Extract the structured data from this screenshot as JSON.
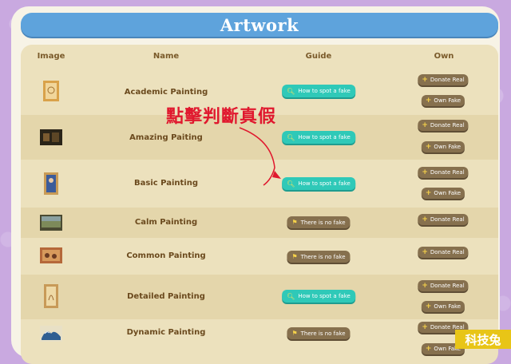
{
  "title": "Artwork",
  "columns": {
    "image": "Image",
    "name": "Name",
    "guide": "Guide",
    "own": "Own"
  },
  "rows": [
    {
      "name": "Academic Painting",
      "guide": "How to spot a fake",
      "fake": true,
      "donate": "Donate Real",
      "own": "Own Fake"
    },
    {
      "name": "Amazing Paiting",
      "guide": "How to spot a fake",
      "fake": true,
      "donate": "Donate Real",
      "own": "Own Fake"
    },
    {
      "name": "Basic Painting",
      "guide": "How to spot a fake",
      "fake": true,
      "donate": "Donate Real",
      "own": "Own Fake"
    },
    {
      "name": "Calm Painting",
      "guide": "There is no fake",
      "fake": false,
      "donate": "Donate Real"
    },
    {
      "name": "Common Painting",
      "guide": "There is no fake",
      "fake": false,
      "donate": "Donate Real"
    },
    {
      "name": "Detailed Painting",
      "guide": "How to spot a fake",
      "fake": true,
      "donate": "Donate Real",
      "own": "Own Fake"
    },
    {
      "name": "Dynamic Painting",
      "guide": "There is no fake",
      "fake": false,
      "donate": "Donate Real",
      "own": "Own Fake"
    }
  ],
  "annotation": "點擊判斷真假",
  "watermark": "科技兔",
  "colors": {
    "accent": "#5ea3dc",
    "guide_button": "#2fc9b8",
    "brown_button": "#86704e",
    "annotation": "#e0182e"
  }
}
